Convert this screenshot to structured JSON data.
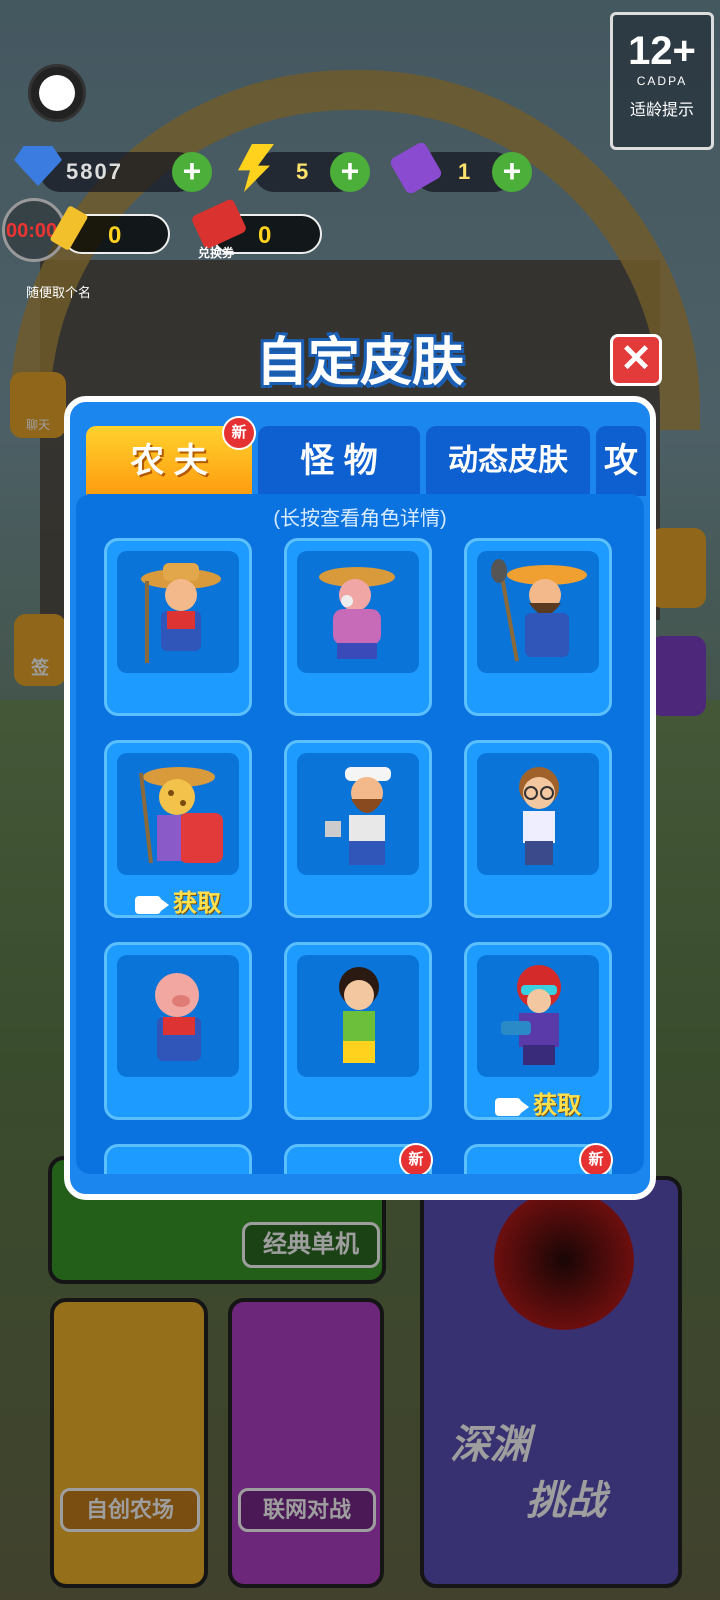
{
  "hud": {
    "diamonds": "5807",
    "energy": "5",
    "tickets": "1",
    "timer": "00:00",
    "gold_tickets": "0",
    "exchange_tickets": "0",
    "exchange_label": "兑换券",
    "random_label": "随便取个名",
    "chat_label": "聊天",
    "signin_label": "签"
  },
  "rating": {
    "age": "12+",
    "org": "CADPA",
    "tip": "适龄提示"
  },
  "dialog": {
    "title": "自定皮肤",
    "tabs": [
      {
        "label": "农 夫",
        "badge": "新"
      },
      {
        "label": "怪 物"
      },
      {
        "label": "动态皮肤"
      },
      {
        "label": "攻"
      }
    ],
    "hint": "(长按查看角色详情)",
    "skins": [
      {
        "name": "farmer-pitchfork",
        "action": ""
      },
      {
        "name": "farmer-old-lady",
        "action": ""
      },
      {
        "name": "farmer-shovel-beard",
        "action": ""
      },
      {
        "name": "farmer-leopard",
        "action": "获取"
      },
      {
        "name": "farmer-axe-bandana",
        "action": ""
      },
      {
        "name": "farmer-nerd",
        "action": ""
      },
      {
        "name": "farmer-pig",
        "action": ""
      },
      {
        "name": "farmer-kid",
        "action": ""
      },
      {
        "name": "farmer-helmet-gunner",
        "action": "获取"
      }
    ],
    "next_row_badges": [
      "",
      "新",
      "新"
    ]
  },
  "menu": {
    "classic": "经典单机",
    "create": "自创农场",
    "online": "联网对战",
    "abyss_line1": "深渊",
    "abyss_line2": "挑战"
  },
  "colors": {
    "panel": "#1c86ef",
    "tab_active": "#ff9b0f",
    "card": "#1e9bff",
    "get_text": "#ffe04d"
  }
}
